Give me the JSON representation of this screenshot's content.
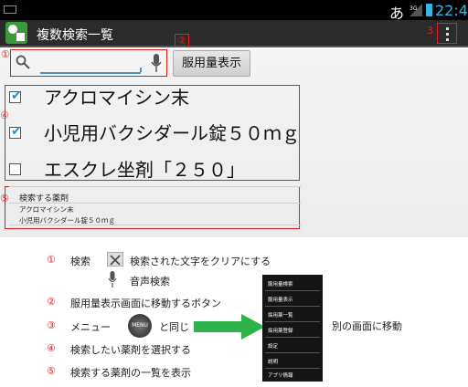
{
  "status_bar": {
    "ime": "あ",
    "network": "3G",
    "time": "22:42"
  },
  "app": {
    "title": "複数検索一覧"
  },
  "search": {
    "value": "",
    "placeholder": ""
  },
  "dose_button_label": "服用量表示",
  "markers": {
    "m1": "①",
    "m2": "②",
    "m3": "3",
    "m4": "④",
    "m5": "⑤"
  },
  "drugs": [
    {
      "name": "アクロマイシン末",
      "checked": true
    },
    {
      "name": "小児用バクシダール錠５０ｍｇ",
      "checked": true
    },
    {
      "name": "エスクレ坐剤「２５０」",
      "checked": false
    }
  ],
  "selected_section": {
    "title": "検索する薬剤",
    "items": [
      "アクロマイシン末",
      "小児用バクシダール錠５０ｍｇ"
    ]
  },
  "legend": [
    {
      "num": "①",
      "text": "検索",
      "text2": "検索された文字をクリアにする"
    },
    {
      "num": "",
      "text": "",
      "text2": "音声検索"
    },
    {
      "num": "②",
      "text": "服用量表示画面に移動するボタン"
    },
    {
      "num": "③",
      "text": "メニュー",
      "text2": "と同じ"
    },
    {
      "num": "④",
      "text": "検索したい薬剤を選択する"
    },
    {
      "num": "⑤",
      "text": "検索する薬剤の一覧を表示"
    }
  ],
  "menu_icon_label": "MENU",
  "other_screen_note": "別の画面に移動",
  "menu_items": [
    "服用量検索",
    "服用量表示",
    "採用薬一覧",
    "採用薬登録",
    "設定",
    "説明",
    "アプリ情報"
  ],
  "colors": {
    "accent_red": "#e02020",
    "accent_blue": "#33b5e5",
    "arrow_green": "#2db34a"
  }
}
